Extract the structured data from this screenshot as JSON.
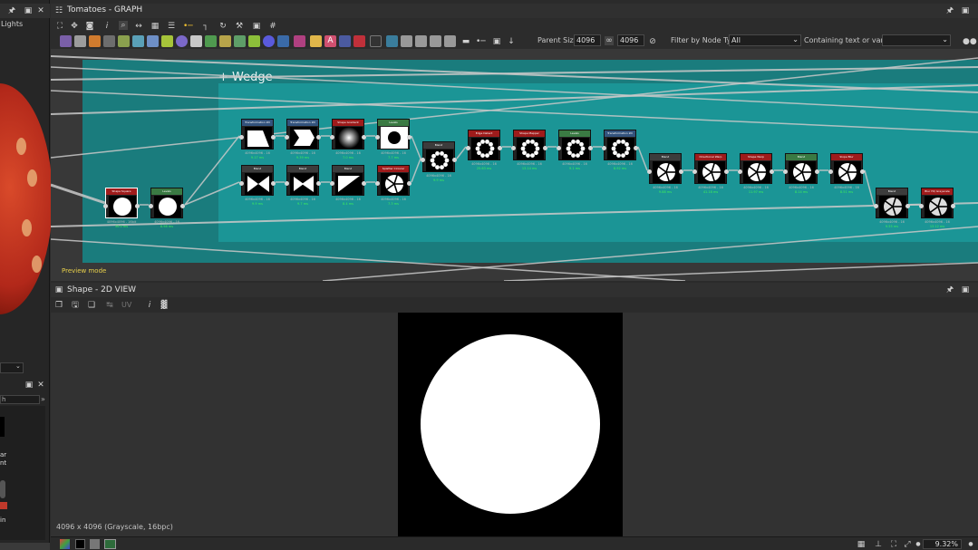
{
  "left_dock": {
    "tab_label": "Lights",
    "text_fragments": [
      "ar",
      "nt",
      "in"
    ],
    "search_text": "h"
  },
  "graph_panel": {
    "title": "Tomatoes - GRAPH",
    "parent_size_label": "Parent Size:",
    "parent_size_value": "4096",
    "size_value": "4096",
    "filter_label": "Filter by Node Type",
    "filter_value": "All",
    "containing_label": "Containing text or variable",
    "frame_title": "+ Wedge",
    "preview_mode": "Preview mode",
    "nodes": [
      {
        "id": "n-source",
        "title": "Shape Square",
        "color": "#9e1b1b",
        "shape": "circle",
        "meta": "4096x4096 - 16bit",
        "time": "30.0 ms"
      },
      {
        "id": "n-levels-a",
        "title": "Levels",
        "color": "#3a7a43",
        "shape": "circle",
        "meta": "4096x4096 - 16",
        "time": "8.98 ms"
      },
      {
        "id": "n-transform-1",
        "title": "Transformation 2D",
        "color": "#33537d",
        "shape": "trap",
        "meta": "4096x4096 - 16",
        "time": "9.17 ms"
      },
      {
        "id": "n-transform-2",
        "title": "Transformation 2D",
        "color": "#33537d",
        "shape": "notch",
        "meta": "4096x4096 - 16",
        "time": "9.39 ms"
      },
      {
        "id": "n-gradient",
        "title": "Shape Gradient",
        "color": "#9e1b1b",
        "shape": "glow",
        "meta": "4096x4096 - 16",
        "time": "7.0 ms"
      },
      {
        "id": "n-levels-b",
        "title": "Levels",
        "color": "#3a7a43",
        "shape": "ring",
        "meta": "4096x4096 - 16",
        "time": "7.7 ms"
      },
      {
        "id": "n-blend-1",
        "title": "Blend",
        "color": "#3c3c3c",
        "shape": "bowtie",
        "meta": "4096x4096 - 16",
        "time": "9.9 ms"
      },
      {
        "id": "n-blend-2",
        "title": "Blend",
        "color": "#3c3c3c",
        "shape": "tri",
        "meta": "4096x4096 - 16",
        "time": "9.7 ms"
      },
      {
        "id": "n-blend-3",
        "title": "Blend",
        "color": "#3c3c3c",
        "shape": "corner",
        "meta": "4096x4096 - 16",
        "time": "8.4 ms"
      },
      {
        "id": "n-splatter",
        "title": "Splatter Circular",
        "color": "#9e1b1b",
        "shape": "pinwheel",
        "meta": "4096x4096 - 16",
        "time": "7.3 ms"
      },
      {
        "id": "n-blend-4",
        "title": "Blend",
        "color": "#3c3c3c",
        "shape": "dashring",
        "meta": "4096x4096 - 16",
        "time": "9.9 ms"
      },
      {
        "id": "n-edge-1",
        "title": "Edge Detect",
        "color": "#9e1b1b",
        "shape": "dashring",
        "meta": "4096x4096 - 16",
        "time": "25.63 ms"
      },
      {
        "id": "n-edge-2",
        "title": "Shape Mapper",
        "color": "#9e1b1b",
        "shape": "dashring",
        "meta": "4096x4096 - 16",
        "time": "13.14 ms"
      },
      {
        "id": "n-levels-c",
        "title": "Levels",
        "color": "#3a7a43",
        "shape": "dashring",
        "meta": "4096x4096 - 16",
        "time": "9.1 ms"
      },
      {
        "id": "n-transform-3",
        "title": "Transformation 2D",
        "color": "#33537d",
        "shape": "dashring",
        "meta": "4096x4096 - 16",
        "time": "8.92 ms"
      },
      {
        "id": "n-blend-5",
        "title": "Blend",
        "color": "#3c3c3c",
        "shape": "pinwheel",
        "meta": "4096x4096 - 16",
        "time": "9.88 ms"
      },
      {
        "id": "n-warp-1",
        "title": "Directional Warp",
        "color": "#9e1b1b",
        "shape": "pinwheel",
        "meta": "4096x4096 - 16",
        "time": "41.18 ms"
      },
      {
        "id": "n-warp-2",
        "title": "Shape Warp",
        "color": "#9e1b1b",
        "shape": "pinwheel",
        "meta": "4096x4096 - 16",
        "time": "11.97 ms"
      },
      {
        "id": "n-blend-6",
        "title": "Blend",
        "color": "#3a7a43",
        "shape": "pinwheel",
        "meta": "4096x4096 - 16",
        "time": "8.14 ms"
      },
      {
        "id": "n-slope",
        "title": "Slope Blur",
        "color": "#9e1b1b",
        "shape": "pinwheel",
        "meta": "4096x4096 - 16",
        "time": "8.51 ms"
      },
      {
        "id": "n-blend-7",
        "title": "Blend",
        "color": "#3c3c3c",
        "shape": "softpin",
        "meta": "4096x4096 - 16",
        "time": "9.55 ms"
      },
      {
        "id": "n-output",
        "title": "Blur HQ Grayscale",
        "color": "#9e1b1b",
        "shape": "softpin",
        "meta": "4096x4096 - 16",
        "time": "13.12 ms"
      }
    ]
  },
  "view_panel": {
    "title": "Shape - 2D VIEW",
    "image_info": "4096 x 4096 (Grayscale, 16bpc)",
    "zoom": "9.32%",
    "uv_label": "UV"
  },
  "colors": {
    "frame_outer": "#1a7c7d",
    "frame_inner": "#1b9596",
    "time_green": "#3df05a",
    "preview_yellow": "#e8d04b"
  }
}
